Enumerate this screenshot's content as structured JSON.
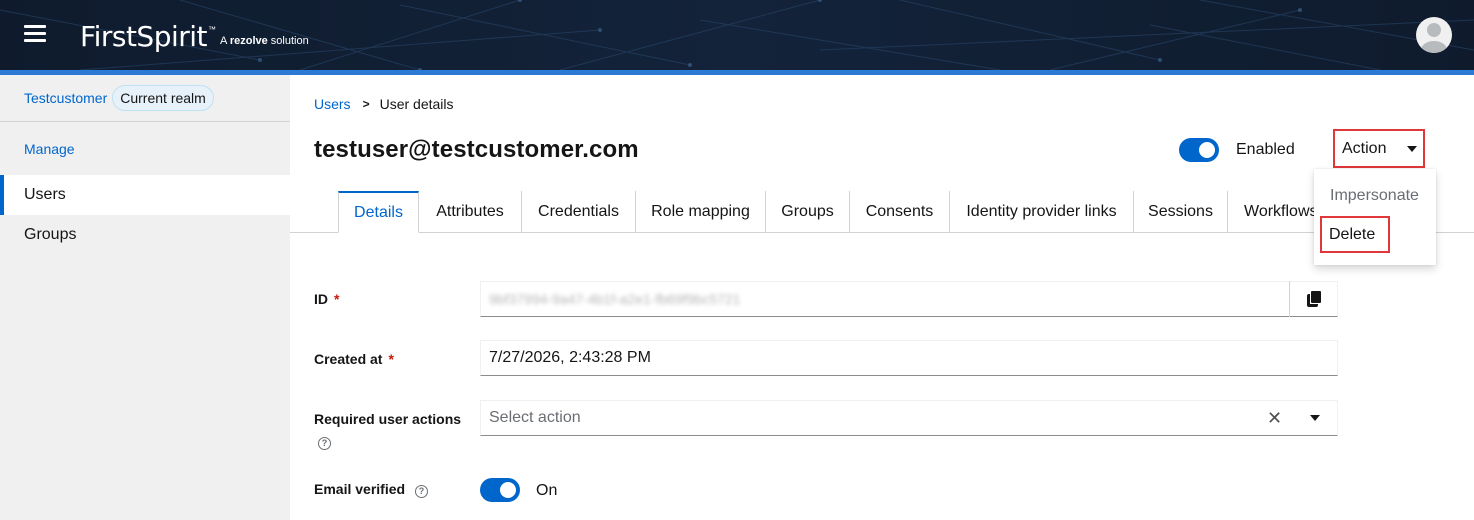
{
  "header": {
    "brand_name": "FirstSpirit",
    "brand_tm": "™",
    "brand_tag_prefix": "A ",
    "brand_tag_company": "rezolve",
    "brand_tag_suffix": " solution",
    "menu_icon": "hamburger-icon",
    "avatar_icon": "user-avatar-icon",
    "accent_color": "#2b7ad6",
    "background_color": "#0f1b2d"
  },
  "sidebar": {
    "realm_name": "Testcustomer",
    "realm_badge": "Current realm",
    "section_label": "Manage",
    "items": [
      {
        "label": "Users",
        "active": true
      },
      {
        "label": "Groups",
        "active": false
      }
    ]
  },
  "breadcrumb": {
    "parent": "Users",
    "separator": ">",
    "current": "User details"
  },
  "page": {
    "title": "testuser@testcustomer.com",
    "enabled_label": "Enabled",
    "enabled_state": true
  },
  "action_menu": {
    "button_label": "Action",
    "items": [
      {
        "label": "Impersonate",
        "disabled": true
      },
      {
        "label": "Delete",
        "highlighted": true
      }
    ],
    "highlight_color": "#e0373a"
  },
  "tabs": [
    {
      "label": "Details",
      "active": true
    },
    {
      "label": "Attributes"
    },
    {
      "label": "Credentials"
    },
    {
      "label": "Role mapping"
    },
    {
      "label": "Groups"
    },
    {
      "label": "Consents"
    },
    {
      "label": "Identity provider links"
    },
    {
      "label": "Sessions"
    },
    {
      "label": "Workflows"
    }
  ],
  "form": {
    "id": {
      "label": "ID",
      "required_mark": "*",
      "value": "9bf37994-9a47-4b1f-a2e1-fb69f9bc5721",
      "copy_icon": "copy-icon"
    },
    "created_at": {
      "label": "Created at",
      "required_mark": "*",
      "value": "7/27/2026, 2:43:28 PM"
    },
    "required_actions": {
      "label": "Required user actions",
      "placeholder": "Select action",
      "help_icon": "help-icon",
      "clear_icon": "clear-icon",
      "toggle_icon": "caret-down-icon"
    },
    "email_verified": {
      "label": "Email verified",
      "help_icon": "help-icon",
      "state_label": "On",
      "checked": true
    }
  },
  "colors": {
    "link": "#06c",
    "required": "#c9190b",
    "sidebar_bg": "#f0f0f0"
  }
}
